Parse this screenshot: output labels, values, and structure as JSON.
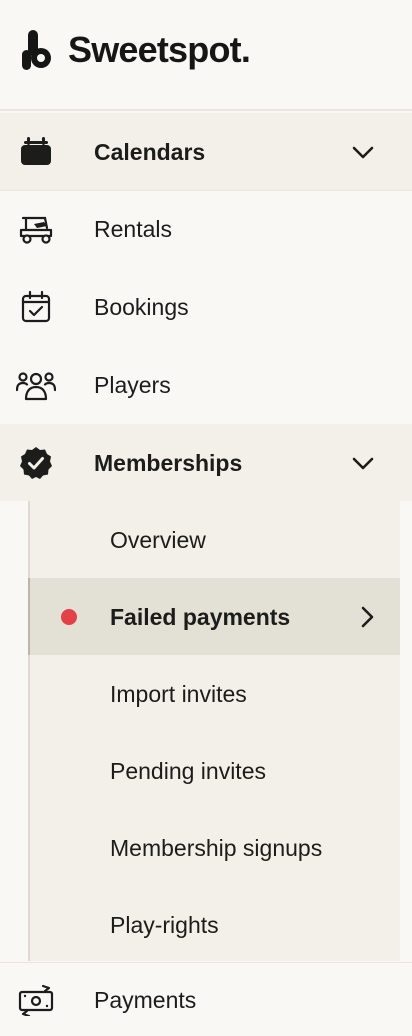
{
  "brand": {
    "name": "Sweetspot."
  },
  "nav": {
    "calendars": {
      "label": "Calendars",
      "icon": "calendar-stack-icon"
    },
    "rentals": {
      "label": "Rentals",
      "icon": "golf-cart-icon"
    },
    "bookings": {
      "label": "Bookings",
      "icon": "calendar-check-icon"
    },
    "players": {
      "label": "Players",
      "icon": "players-group-icon"
    },
    "memberships": {
      "label": "Memberships",
      "icon": "verified-badge-icon"
    },
    "payments": {
      "label": "Payments",
      "icon": "money-transfer-icon"
    }
  },
  "memberships_sub": [
    {
      "label": "Overview"
    },
    {
      "label": "Failed payments",
      "active": true,
      "alert_color": "#e34048"
    },
    {
      "label": "Import invites"
    },
    {
      "label": "Pending invites"
    },
    {
      "label": "Membership signups"
    },
    {
      "label": "Play-rights"
    }
  ],
  "colors": {
    "background": "#f9f8f4",
    "expanded_background": "#f2f0e8",
    "active_background": "#e3e0d5",
    "text": "#1c1c1a",
    "alert": "#e34048"
  }
}
